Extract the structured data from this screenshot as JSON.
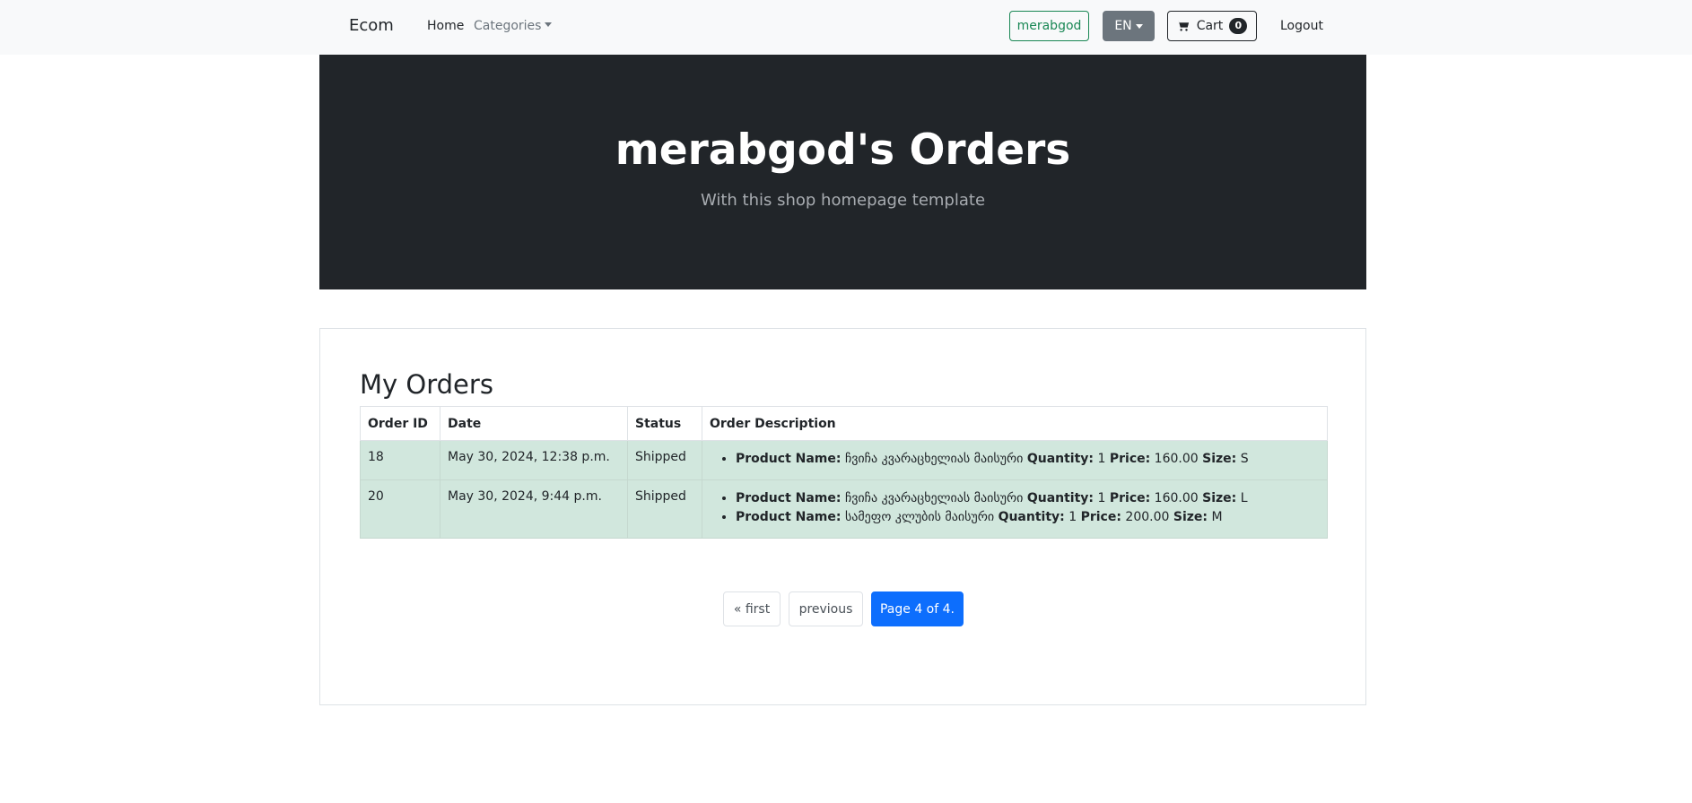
{
  "navbar": {
    "brand": "Ecom",
    "links": {
      "home": "Home",
      "categories": "Categories",
      "logout": "Logout"
    },
    "user_button": "merabgod",
    "lang_button": "EN",
    "cart": {
      "label": "Cart",
      "count": "0"
    }
  },
  "header": {
    "title": "merabgod's Orders",
    "subtitle": "With this shop homepage template"
  },
  "orders": {
    "heading": "My Orders",
    "columns": [
      "Order ID",
      "Date",
      "Status",
      "Order Description"
    ],
    "field_labels": {
      "product": "Product Name:",
      "quantity": "Quantity:",
      "price": "Price:",
      "size": "Size:"
    },
    "rows": [
      {
        "id": "18",
        "date": "May 30, 2024, 12:38 p.m.",
        "status": "Shipped",
        "items": [
          {
            "product": "ჩვიჩა კვარაცხელიას მაისური",
            "quantity": "1",
            "price": "160.00",
            "size": "S"
          }
        ]
      },
      {
        "id": "20",
        "date": "May 30, 2024, 9:44 p.m.",
        "status": "Shipped",
        "items": [
          {
            "product": "ჩვიჩა კვარაცხელიას მაისური",
            "quantity": "1",
            "price": "160.00",
            "size": "L"
          },
          {
            "product": "სამეფო კლუბის მაისური",
            "quantity": "1",
            "price": "200.00",
            "size": "M"
          }
        ]
      }
    ]
  },
  "pagination": {
    "first": "« first",
    "previous": "previous",
    "current": "Page 4 of 4."
  },
  "colors": {
    "navbar_bg": "#f8f9fa",
    "hero_bg": "#212529",
    "success": "#198754",
    "secondary": "#6c757d",
    "row_success_bg": "#d1e7dd",
    "primary": "#0d6efd"
  },
  "icons": {
    "cart": "cart-icon",
    "dropdown": "caret-down-icon"
  }
}
